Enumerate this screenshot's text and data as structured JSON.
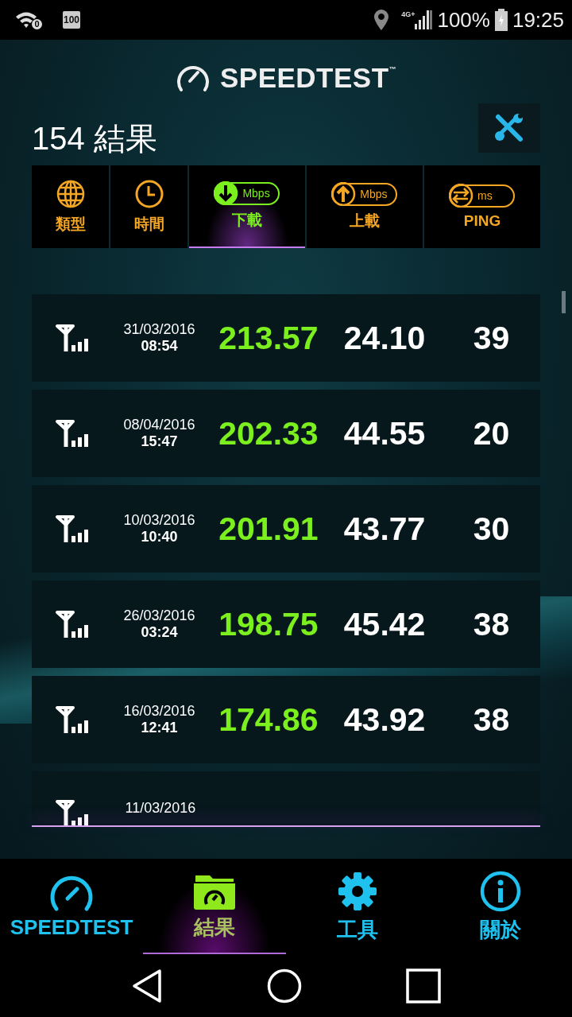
{
  "status_bar": {
    "wifi_badge": "0",
    "notification_badge": "100",
    "network": "4G+",
    "battery": "100%",
    "time": "19:25"
  },
  "header": {
    "logo": "SPEEDTEST",
    "trademark": "™"
  },
  "results": {
    "title": "154 結果"
  },
  "sort_tabs": [
    {
      "kind": "globe",
      "label": "類型",
      "selected": false
    },
    {
      "kind": "clock",
      "label": "時間",
      "selected": false
    },
    {
      "kind": "download",
      "unit": "Mbps",
      "label": "下載",
      "selected": true
    },
    {
      "kind": "upload",
      "unit": "Mbps",
      "label": "上載",
      "selected": false
    },
    {
      "kind": "ping",
      "unit": "ms",
      "label": "PING",
      "selected": false
    }
  ],
  "rows": [
    {
      "kind": "cellular",
      "date": "31/03/2016",
      "time": "08:54",
      "download": "213.57",
      "upload": "24.10",
      "ping": "39"
    },
    {
      "kind": "cellular",
      "date": "08/04/2016",
      "time": "15:47",
      "download": "202.33",
      "upload": "44.55",
      "ping": "20"
    },
    {
      "kind": "cellular",
      "date": "10/03/2016",
      "time": "10:40",
      "download": "201.91",
      "upload": "43.77",
      "ping": "30"
    },
    {
      "kind": "cellular",
      "date": "26/03/2016",
      "time": "03:24",
      "download": "198.75",
      "upload": "45.42",
      "ping": "38"
    },
    {
      "kind": "cellular",
      "date": "16/03/2016",
      "time": "12:41",
      "download": "174.86",
      "upload": "43.92",
      "ping": "38"
    },
    {
      "kind": "cellular",
      "date": "11/03/2016"
    }
  ],
  "bottom_nav": [
    {
      "kind": "gauge",
      "label": "SPEEDTEST",
      "selected": false
    },
    {
      "kind": "folder",
      "label": "結果",
      "selected": true
    },
    {
      "kind": "gear",
      "label": "工具",
      "selected": false
    },
    {
      "kind": "info",
      "label": "關於",
      "selected": false
    }
  ]
}
